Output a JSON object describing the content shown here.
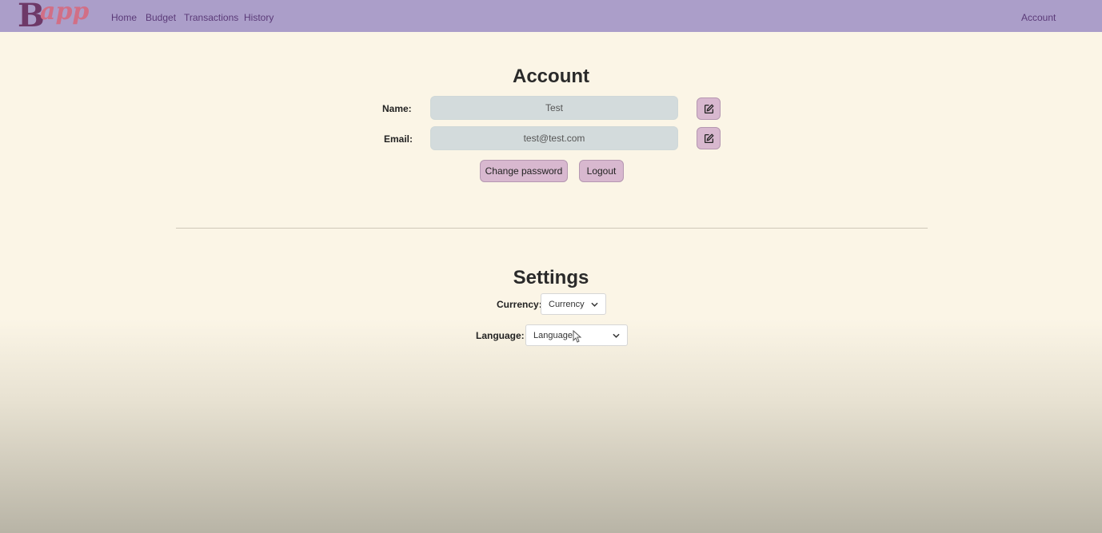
{
  "nav": {
    "logo_initial": "B",
    "logo_rest": "app",
    "links": [
      "Home",
      "Budget",
      "Transactions",
      "History"
    ],
    "account_link": "Account"
  },
  "account": {
    "title": "Account",
    "name_label": "Name:",
    "name_value": "Test",
    "email_label": "Email:",
    "email_value": "test@test.com",
    "change_password_label": "Change password",
    "logout_label": "Logout"
  },
  "settings": {
    "title": "Settings",
    "currency_label": "Currency:",
    "currency_value": "Currency",
    "language_label": "Language:",
    "language_value": "Language"
  },
  "colors": {
    "navbar": "#ab9ec9",
    "page_background": "#fbf5e6",
    "input_background": "#d3dbdc",
    "button_background": "#d8b8cf",
    "nav_link": "#5b3a78"
  },
  "icons": {
    "edit": "edit-icon",
    "dropdown": "chevron-down-icon"
  }
}
